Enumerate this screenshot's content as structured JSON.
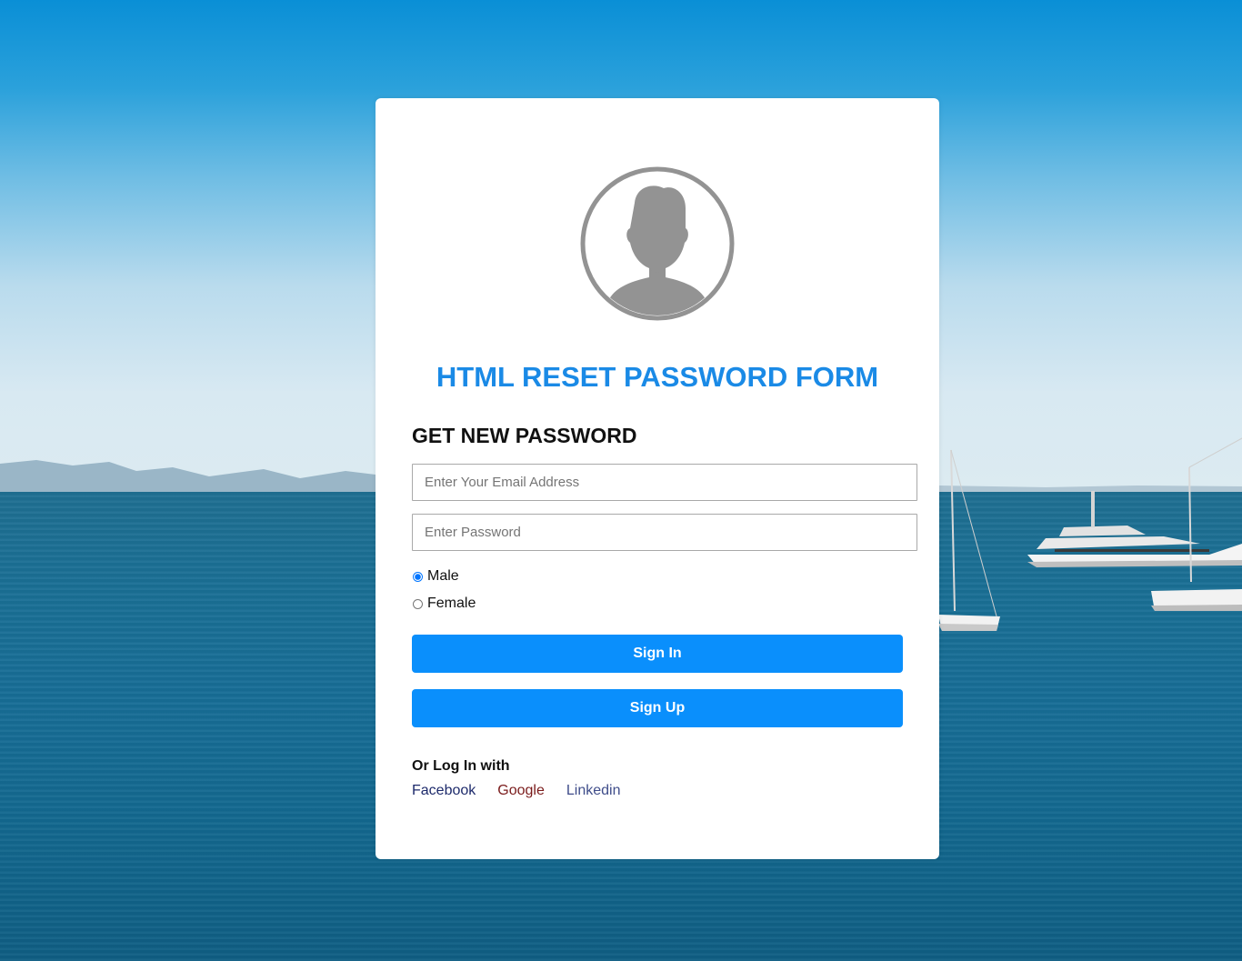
{
  "form": {
    "title": "HTML RESET PASSWORD FORM",
    "subtitle": "GET NEW PASSWORD",
    "email_placeholder": "Enter Your Email Address",
    "password_placeholder": "Enter Password",
    "gender_options": [
      {
        "label": "Male",
        "checked": true
      },
      {
        "label": "Female",
        "checked": false
      }
    ],
    "signin_label": "Sign In",
    "signup_label": "Sign Up",
    "or_login_label": "Or Log In with",
    "social_links": [
      "Facebook",
      "Google",
      "Linkedin"
    ]
  },
  "colors": {
    "accent": "#0a8ffc",
    "title": "#1a8ae6",
    "avatar": "#939393",
    "facebook": "#1d2a6b",
    "google": "#7a1b1b",
    "linkedin": "#3f4d8a"
  },
  "icons": {
    "avatar": "user-avatar-icon"
  }
}
